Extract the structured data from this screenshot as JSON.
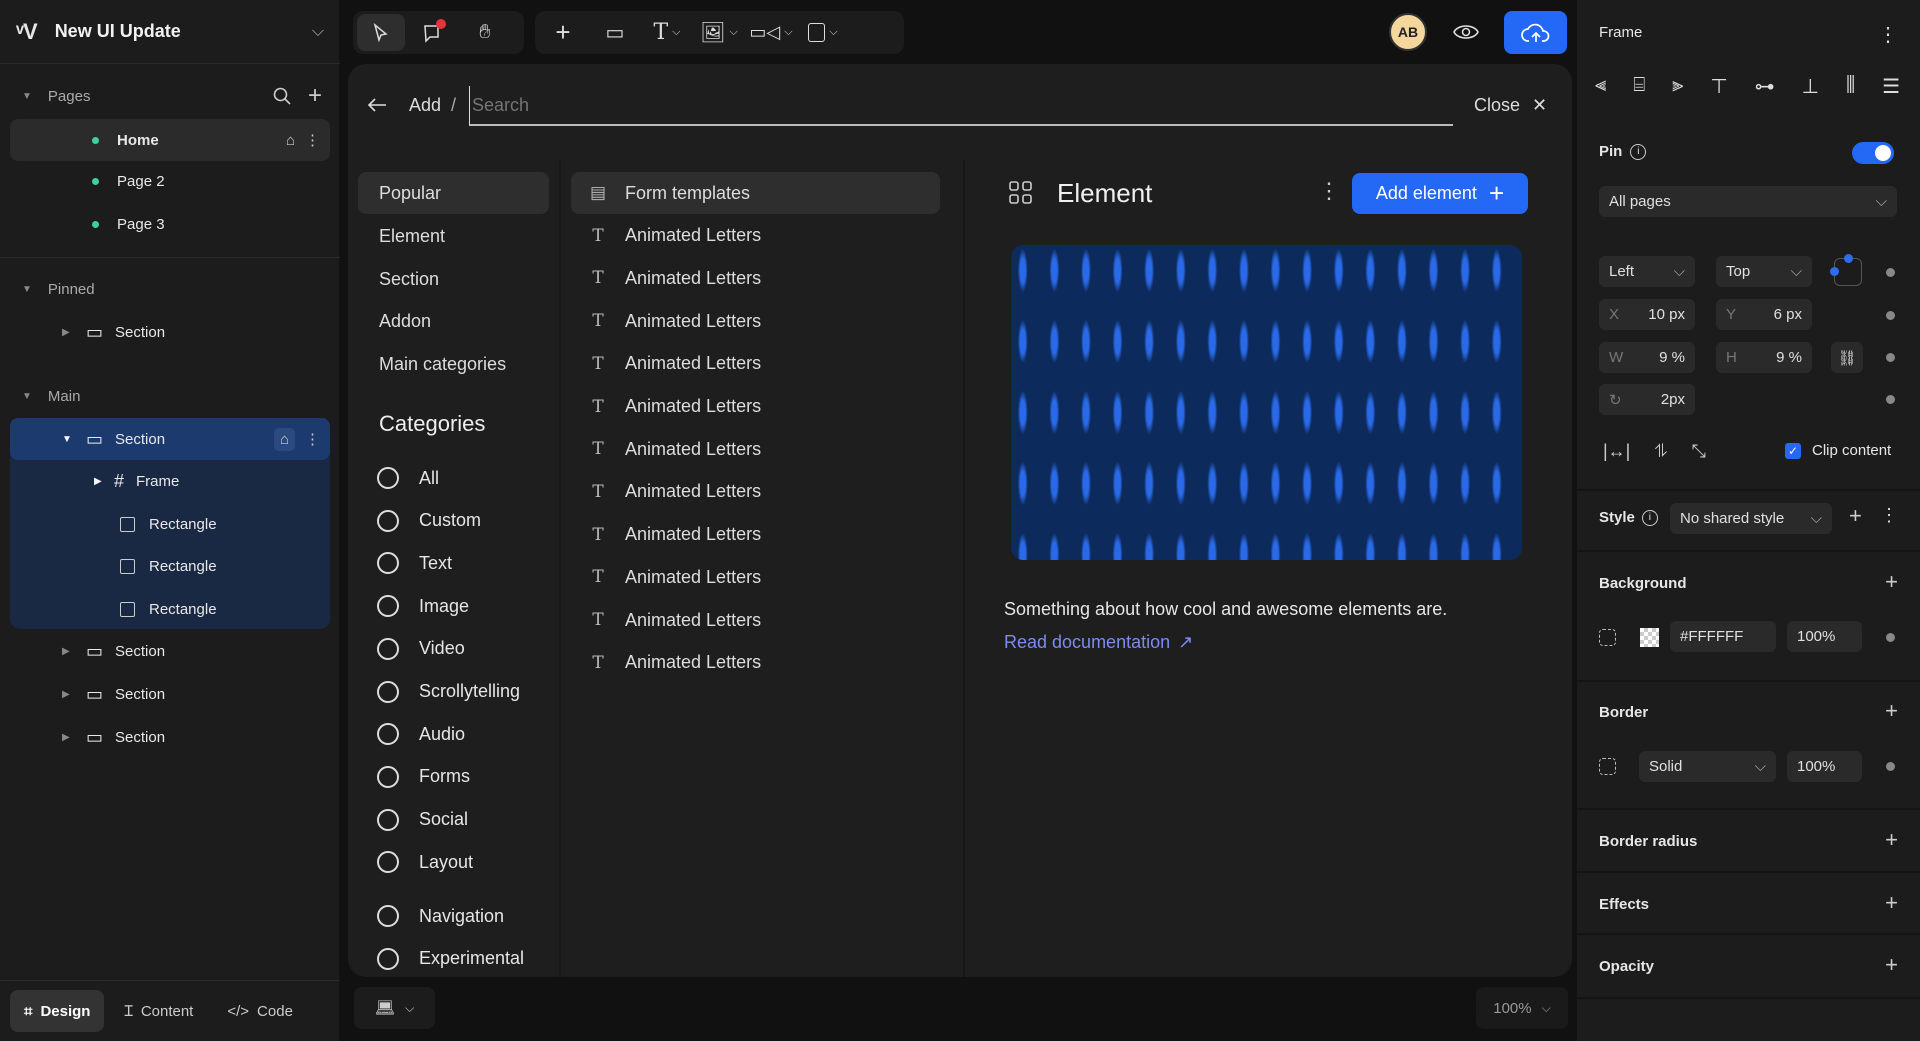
{
  "project": {
    "logo": "VEV",
    "title": "New UI Update"
  },
  "layers": {
    "pages_label": "Pages",
    "pages": [
      {
        "label": "Home"
      },
      {
        "label": "Page 2"
      },
      {
        "label": "Page 3"
      }
    ],
    "pinned_label": "Pinned",
    "pinned": [
      {
        "label": "Section"
      }
    ],
    "main_label": "Main",
    "main": [
      {
        "label": "Section"
      },
      {
        "label": "Frame"
      },
      {
        "label": "Rectangle"
      },
      {
        "label": "Rectangle"
      },
      {
        "label": "Rectangle"
      },
      {
        "label": "Section"
      },
      {
        "label": "Section"
      },
      {
        "label": "Section"
      }
    ]
  },
  "mode_tabs": [
    {
      "label": "Design",
      "active": true
    },
    {
      "label": "Content"
    },
    {
      "label": "Code"
    }
  ],
  "toolbar": {
    "avatar": "AB",
    "comment_badge_color": "#e5333b",
    "accent": "#2469f5"
  },
  "add_panel": {
    "breadcrumb_root": "Add",
    "breadcrumb_sep": "/",
    "search_placeholder": "Search",
    "close_label": "Close",
    "nav": [
      "Popular",
      "Element",
      "Section",
      "Addon",
      "Main categories"
    ],
    "categories_title": "Categories",
    "categories": [
      "All",
      "Custom",
      "Text",
      "Image",
      "Video",
      "Scrollytelling",
      "Audio",
      "Forms",
      "Social",
      "Layout",
      "Navigation",
      "Experimental"
    ],
    "items": [
      {
        "label": "Form templates",
        "icon": "form-icon"
      },
      {
        "label": "Animated Letters"
      },
      {
        "label": "Animated Letters"
      },
      {
        "label": "Animated Letters"
      },
      {
        "label": "Animated Letters"
      },
      {
        "label": "Animated Letters"
      },
      {
        "label": "Animated Letters"
      },
      {
        "label": "Animated Letters"
      },
      {
        "label": "Animated Letters"
      },
      {
        "label": "Animated Letters"
      },
      {
        "label": "Animated Letters"
      },
      {
        "label": "Animated Letters"
      }
    ],
    "detail": {
      "title": "Element",
      "add_label": "Add element",
      "description": "Something about how cool and awesome elements are.",
      "doc_link": "Read documentation"
    }
  },
  "bottom": {
    "zoom": "100%"
  },
  "inspector": {
    "title": "Frame",
    "pin_label": "Pin",
    "pin_on": true,
    "pin_scope": "All pages",
    "h_anchor": "Left",
    "v_anchor": "Top",
    "x_label": "X",
    "x": "10 px",
    "y_label": "Y",
    "y": "6 px",
    "w_label": "W",
    "w": "9 %",
    "h_label": "H",
    "h": "9 %",
    "rotation": "2px",
    "clip_label": "Clip content",
    "clip_on": true,
    "style_label": "Style",
    "style_value": "No shared style",
    "background_label": "Background",
    "bg_color": "#FFFFFF",
    "bg_opacity": "100%",
    "border_label": "Border",
    "border_style": "Solid",
    "border_opacity": "100%",
    "radius_label": "Border radius",
    "effects_label": "Effects",
    "opacity_label": "Opacity"
  }
}
